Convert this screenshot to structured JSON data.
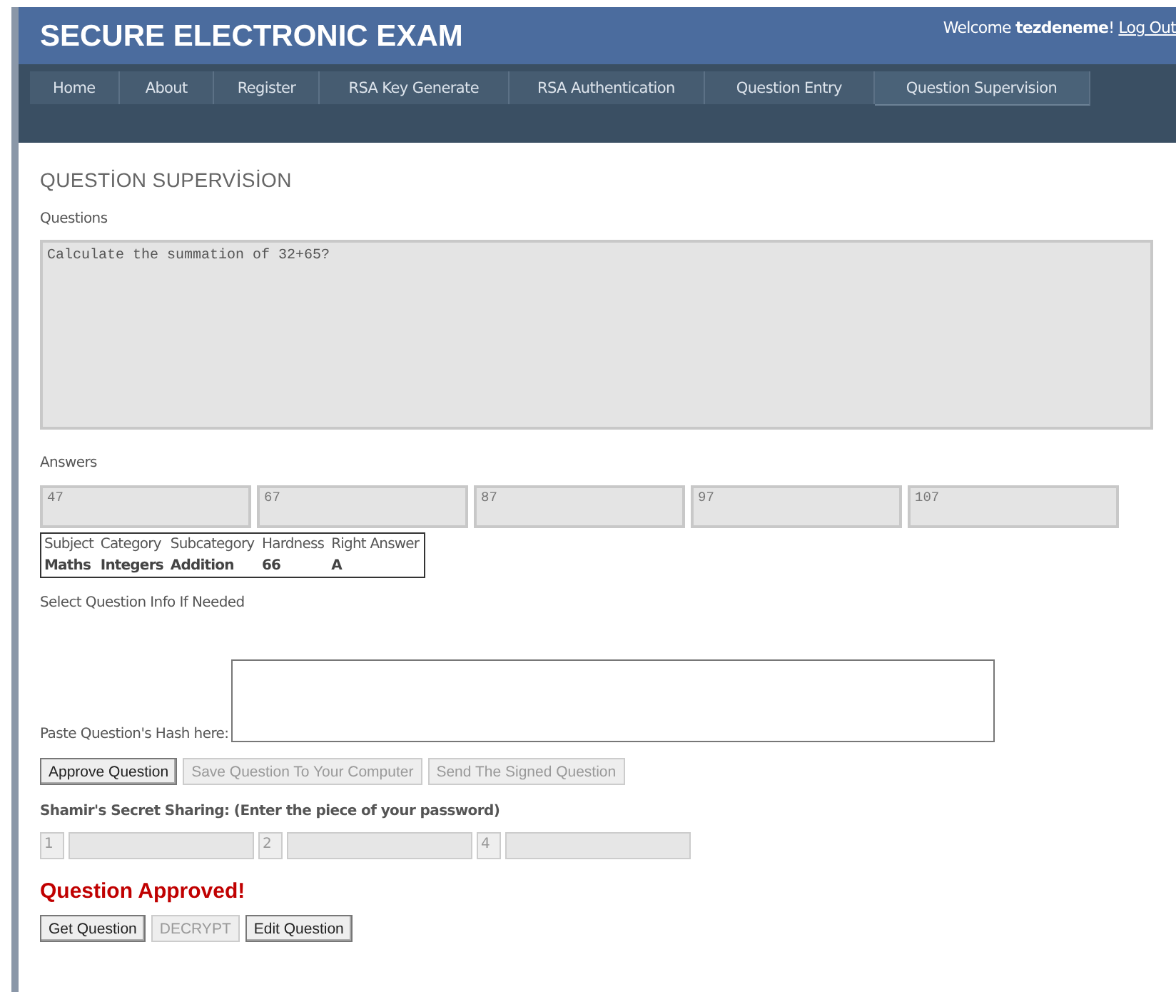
{
  "header": {
    "title": "SECURE ELECTRONIC EXAM",
    "welcome_prefix": "Welcome ",
    "username": "tezdeneme",
    "welcome_suffix": "!",
    "logout": "Log Out"
  },
  "nav": [
    {
      "label": "Home",
      "selected": false
    },
    {
      "label": "About",
      "selected": false
    },
    {
      "label": "Register",
      "selected": false
    },
    {
      "label": "RSA Key Generate",
      "selected": false
    },
    {
      "label": "RSA Authentication",
      "selected": false
    },
    {
      "label": "Question Entry",
      "selected": false
    },
    {
      "label": "Question Supervision",
      "selected": true
    }
  ],
  "page_title": "QUESTİON SUPERVİSİON",
  "questions": {
    "label": "Questions",
    "value": "Calculate the summation of 32+65?"
  },
  "answers": {
    "label": "Answers",
    "values": [
      "47",
      "67",
      "87",
      "97",
      "107"
    ]
  },
  "info_table": {
    "columns": [
      "Subject",
      "Category",
      "Subcategory",
      "Hardness",
      "Right Answer"
    ],
    "row": [
      "Maths",
      "Integers",
      "Addition",
      "66",
      "A"
    ]
  },
  "select_info_label": "Select Question Info If Needed",
  "hash": {
    "label": "Paste Question's Hash here:"
  },
  "actions": [
    {
      "label": "Approve Question",
      "disabled": false
    },
    {
      "label": "Save Question To Your Computer",
      "disabled": true
    },
    {
      "label": "Send The Signed Question",
      "disabled": true
    }
  ],
  "shamir": {
    "label": "Shamir's Secret Sharing: (Enter the piece of your password)",
    "pieces": [
      {
        "number": "1"
      },
      {
        "number": "2"
      },
      {
        "number": "4"
      }
    ]
  },
  "status": "Question Approved!",
  "bottom_actions": [
    {
      "label": "Get Question",
      "disabled": false
    },
    {
      "label": "DECRYPT",
      "disabled": true
    },
    {
      "label": "Edit Question",
      "disabled": false
    }
  ]
}
